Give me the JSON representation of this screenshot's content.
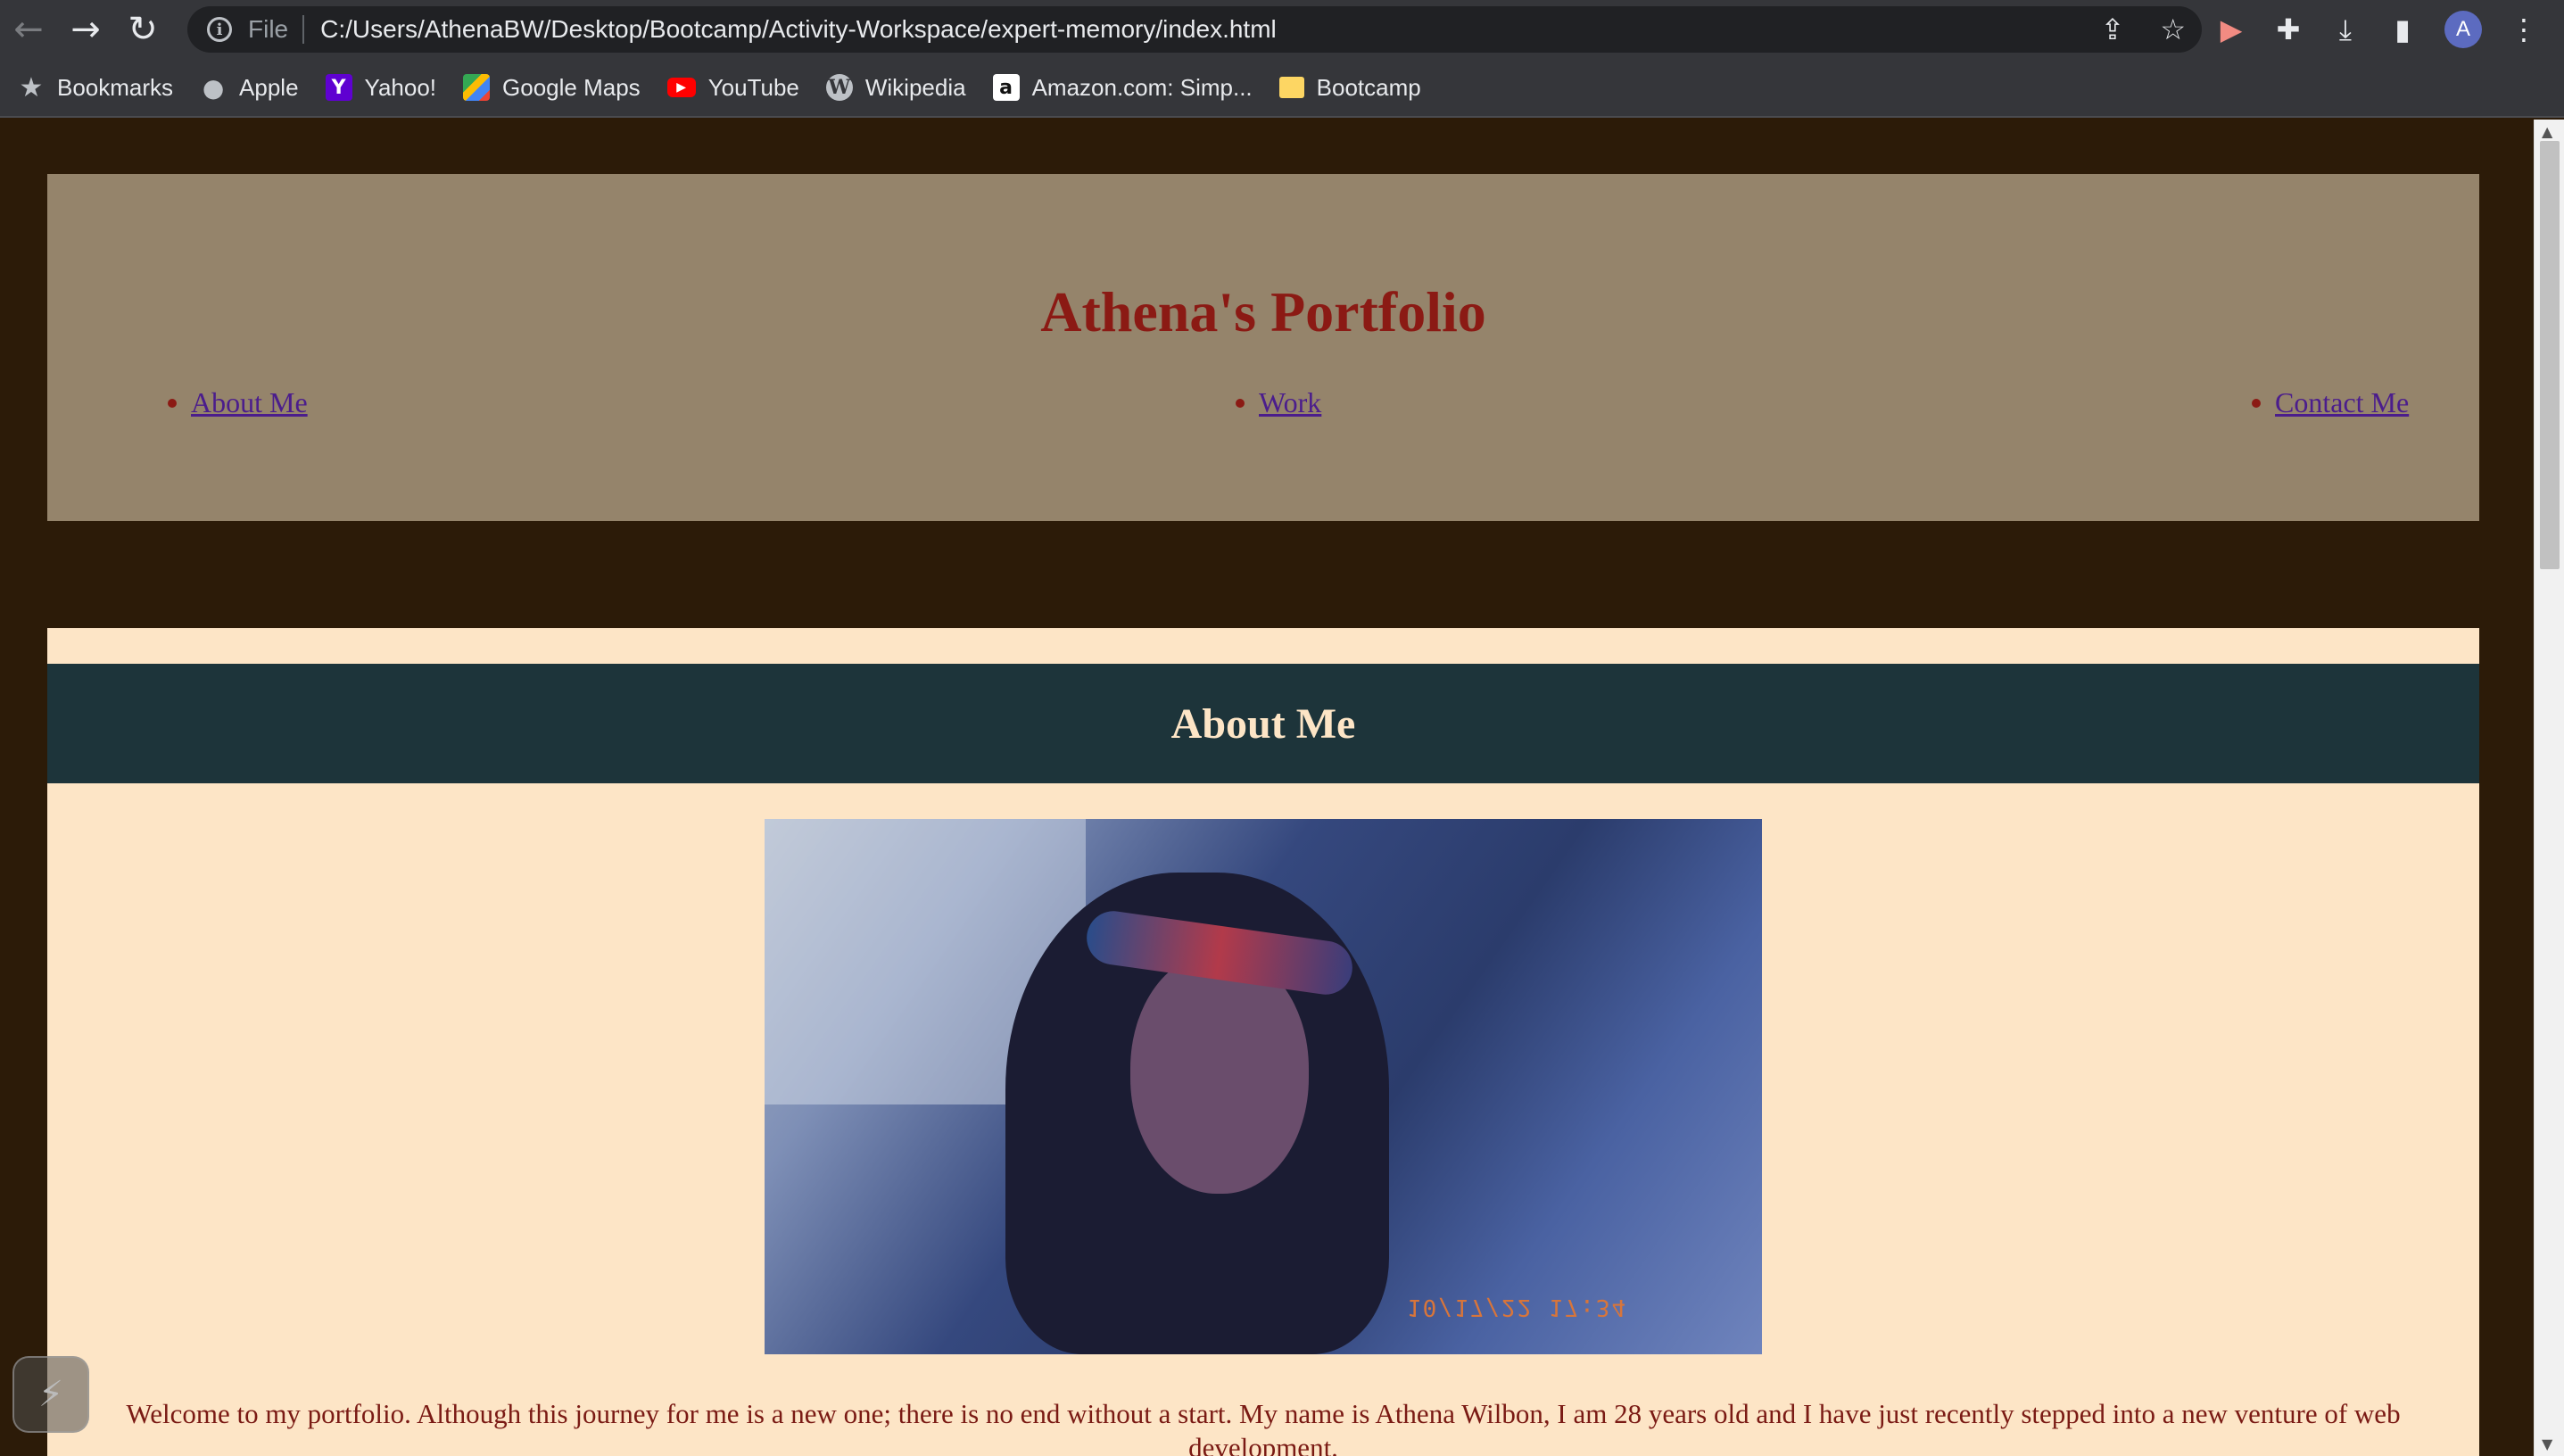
{
  "browser": {
    "file_label": "File",
    "url": "C:/Users/AthenaBW/Desktop/Bootcamp/Activity-Workspace/expert-memory/index.html",
    "profile_initial": "A",
    "icons": [
      "back-arrow-icon",
      "forward-arrow-icon",
      "reload-icon",
      "info-icon",
      "share-icon",
      "star-icon",
      "extension-icon",
      "puzzle-icon",
      "download-icon",
      "side-panel-icon",
      "menu-icon"
    ]
  },
  "bookmarks": [
    {
      "label": "Bookmarks",
      "icon": "star-icon"
    },
    {
      "label": "Apple",
      "icon": "apple-icon"
    },
    {
      "label": "Yahoo!",
      "icon": "yahoo-icon",
      "glyph": "Y"
    },
    {
      "label": "Google Maps",
      "icon": "google-maps-icon"
    },
    {
      "label": "YouTube",
      "icon": "youtube-icon",
      "glyph": "▶"
    },
    {
      "label": "Wikipedia",
      "icon": "wikipedia-icon",
      "glyph": "W"
    },
    {
      "label": "Amazon.com: Simp...",
      "icon": "amazon-icon",
      "glyph": "a"
    },
    {
      "label": "Bootcamp",
      "icon": "folder-icon"
    }
  ],
  "site": {
    "title": "Athena's Portfolio",
    "nav": [
      "About Me",
      "Work",
      "Contact Me"
    ]
  },
  "about": {
    "heading": "About Me",
    "photo_stamp": "10/17/22 17:34",
    "text": "Welcome to my portfolio. Although this journey for me is a new one; there is no end without a start. My name is Athena Wilbon, I am 28 years old and I have just recently stepped into a new venture of web development."
  },
  "colors": {
    "page_bg": "#2c1b08",
    "header_bg": "#95846b",
    "title": "#8b1a14",
    "link": "#4b1d8c",
    "section_bg": "#fde5c6",
    "section_head_bg": "#1d343a"
  }
}
